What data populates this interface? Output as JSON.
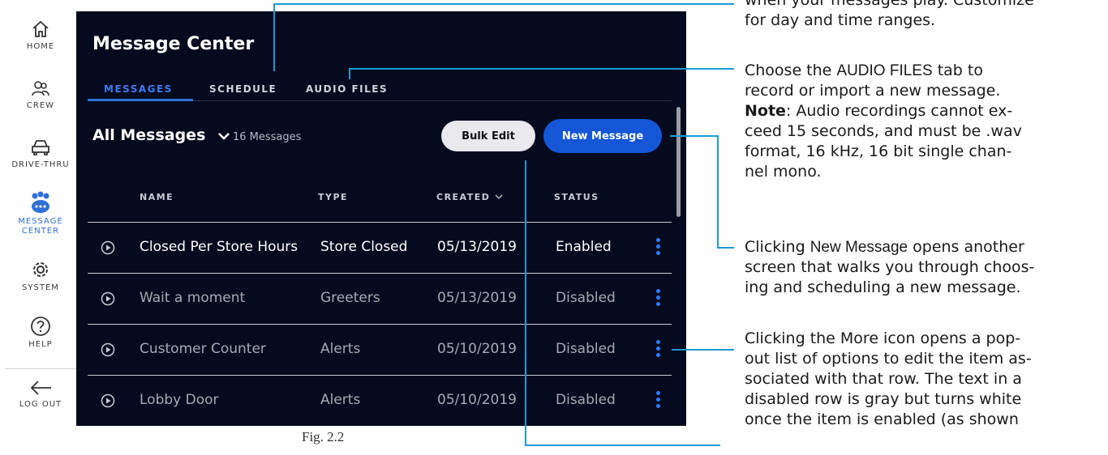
{
  "nav": {
    "items": [
      {
        "label": "HOME",
        "icon": "home-icon"
      },
      {
        "label": "CREW",
        "icon": "crew-icon"
      },
      {
        "label": "DRIVE-THRU",
        "icon": "car-icon"
      },
      {
        "label_line1": "MESSAGE",
        "label_line2": "CENTER",
        "icon": "message-center-icon",
        "active": true
      },
      {
        "label": "SYSTEM",
        "icon": "gear-icon"
      },
      {
        "label": "HELP",
        "icon": "help-icon"
      },
      {
        "label": "LOG OUT",
        "icon": "arrow-left-icon"
      }
    ]
  },
  "app": {
    "title": "Message Center",
    "tabs": [
      {
        "label": "MESSAGES",
        "active": true
      },
      {
        "label": "SCHEDULE"
      },
      {
        "label": "AUDIO FILES"
      }
    ],
    "filter_label": "All Messages",
    "count_label": "16 Messages",
    "bulk_edit_label": "Bulk Edit",
    "new_message_label": "New Message",
    "columns": {
      "name": "NAME",
      "type": "TYPE",
      "created": "CREATED",
      "status": "STATUS"
    },
    "rows": [
      {
        "name": "Closed Per Store Hours",
        "type": "Store Closed",
        "created": "05/13/2019",
        "status": "Enabled"
      },
      {
        "name": "Wait a moment",
        "type": "Greeters",
        "created": "05/13/2019",
        "status": "Disabled"
      },
      {
        "name": "Customer Counter",
        "type": "Alerts",
        "created": "05/10/2019",
        "status": "Disabled"
      },
      {
        "name": "Lobby Door",
        "type": "Alerts",
        "created": "05/10/2019",
        "status": "Disabled"
      }
    ]
  },
  "callouts": {
    "schedule_line1": "when your messages play. Customize",
    "schedule_line2": "for day and time ranges.",
    "audio_1": "Choose the ",
    "audio_tab": "AUDIO FILES",
    "audio_2": " tab to",
    "audio_3": "record or import a new message.",
    "audio_note": "Note",
    "audio_4": ": Audio recordings cannot ex-",
    "audio_5": "ceed 15 seconds, and must be .wav",
    "audio_6": "format, 16 kHz, 16 bit single chan-",
    "audio_7": "nel mono.",
    "new_1": "Clicking ",
    "new_btn": "New Message",
    "new_2": " opens another",
    "new_3": "screen that walks you through choos-",
    "new_4": "ing and scheduling a new message.",
    "more_1": "Clicking the More icon opens a pop-",
    "more_2": "out list of options to edit the item as-",
    "more_3": "sociated with that row. The text in a",
    "more_4": "disabled row is gray but turns white",
    "more_5": "once the item is enabled (as shown"
  },
  "caption": "Fig. 2.2",
  "colors": {
    "panel": "#050a1e",
    "accent": "#1456d6",
    "tab_active": "#3d7cf0",
    "more_dots": "#2f7bff",
    "callout_line": "#1a9ad6"
  }
}
